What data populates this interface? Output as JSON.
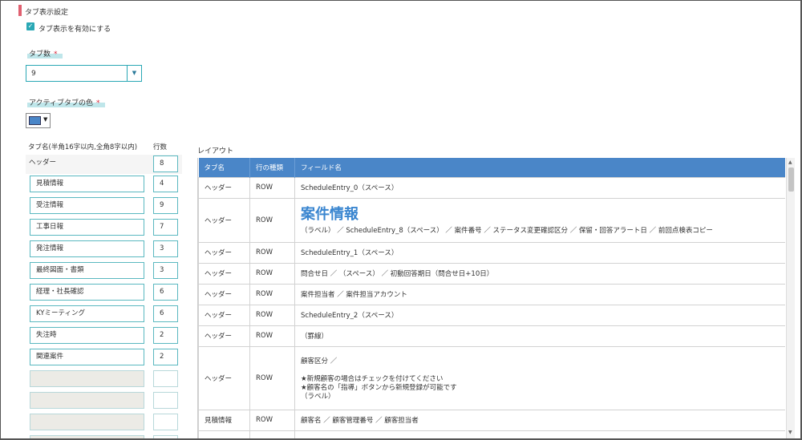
{
  "section_title": "タブ表示設定",
  "enable_tabs": {
    "label": "タブ表示を有効にする",
    "checked": true
  },
  "tab_count": {
    "label": "タブ数",
    "required_mark": "*",
    "value": "9"
  },
  "active_color": {
    "label": "アクティブタブの色",
    "required_mark": "*",
    "color": "#4a86c8"
  },
  "tab_list": {
    "name_header": "タブ名(半角16字以内,全角8字以内)",
    "rows_header": "行数",
    "items": [
      {
        "name": "ヘッダー",
        "rows": "8"
      },
      {
        "name": "見積情報",
        "rows": "4"
      },
      {
        "name": "受注情報",
        "rows": "9"
      },
      {
        "name": "工事日報",
        "rows": "7"
      },
      {
        "name": "発注情報",
        "rows": "3"
      },
      {
        "name": "最終図面・書類",
        "rows": "3"
      },
      {
        "name": "経理・社長確認",
        "rows": "6"
      },
      {
        "name": "KYミーティング",
        "rows": "6"
      },
      {
        "name": "失注時",
        "rows": "2"
      },
      {
        "name": "関連案件",
        "rows": "2"
      },
      {
        "name": "",
        "rows": ""
      },
      {
        "name": "",
        "rows": ""
      },
      {
        "name": "",
        "rows": ""
      },
      {
        "name": "",
        "rows": ""
      }
    ]
  },
  "layout": {
    "label": "レイアウト",
    "columns": [
      "タブ名",
      "行の種類",
      "フィールド名"
    ],
    "rows": [
      {
        "tab": "ヘッダー",
        "type": "ROW",
        "fields": "ScheduleEntry_0（スペース）"
      },
      {
        "tab": "ヘッダー",
        "type": "ROW",
        "big": "案件情報",
        "fields": "（ラベル） ／ ScheduleEntry_8（スペース） ／ 案件番号 ／ ステータス変更確認区分 ／ 保留・回答アラート日 ／ 前回点検表コピー"
      },
      {
        "tab": "ヘッダー",
        "type": "ROW",
        "fields": "ScheduleEntry_1（スペース）"
      },
      {
        "tab": "ヘッダー",
        "type": "ROW",
        "fields": "問合せ日 ／ （スペース） ／ 初動回答期日（問合せ日+10日）"
      },
      {
        "tab": "ヘッダー",
        "type": "ROW",
        "fields": "案件担当者 ／ 案件担当アカウント"
      },
      {
        "tab": "ヘッダー",
        "type": "ROW",
        "fields": "ScheduleEntry_2（スペース）"
      },
      {
        "tab": "ヘッダー",
        "type": "ROW",
        "fields": "（罫線）"
      },
      {
        "tab": "ヘッダー",
        "type": "ROW",
        "lines": [
          "顧客区分 ／",
          "",
          "★新規顧客の場合はチェックを付けてください",
          "★顧客名の「指導」ボタンから新規登録が可能です",
          "（ラベル）"
        ]
      },
      {
        "tab": "見積情報",
        "type": "ROW",
        "fields": "顧客名 ／ 顧客管理番号 ／ 顧客担当者"
      },
      {
        "tab": "",
        "type": "",
        "fields": ""
      }
    ]
  }
}
